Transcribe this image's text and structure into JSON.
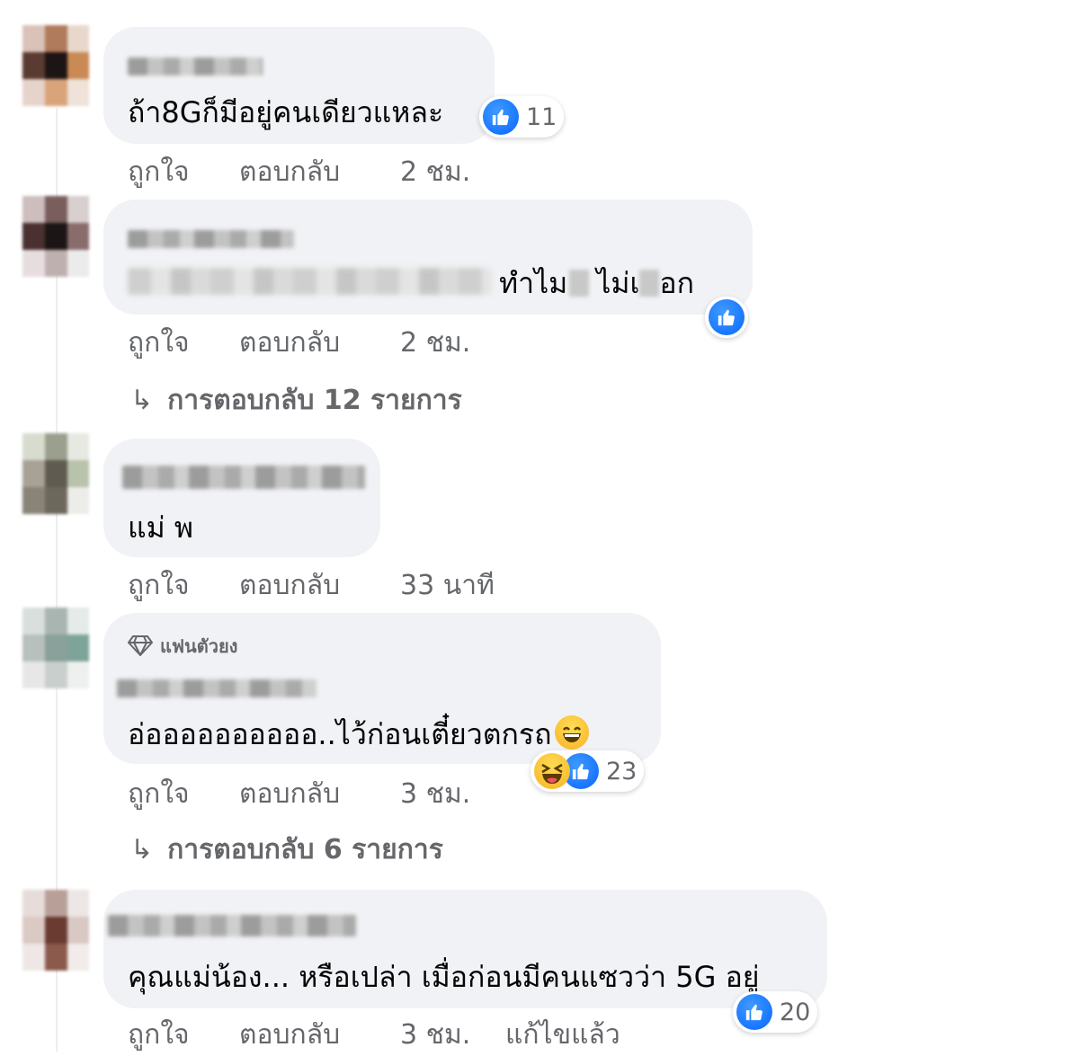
{
  "actions": {
    "like": "ถูกใจ",
    "reply": "ตอบกลับ"
  },
  "icons": {
    "reaction_like": "like-icon",
    "reaction_haha": "haha-icon",
    "reply_arrow": "reply-arrow-icon",
    "badge": "diamond-icon"
  },
  "colors": {
    "like_blue": "#0866ff",
    "bubble_bg": "#f0f2f5",
    "secondary_text": "#65676b"
  },
  "comments": [
    {
      "text": "ถ้า8Gก็มีอยู่คนเดียวแหละ",
      "time": "2 ชม.",
      "reaction_count": "11"
    },
    {
      "text_visible_1": "ทำไม",
      "text_visible_2": "ไม่เ",
      "text_visible_3": "อก",
      "time": "2 ชม.",
      "replies_label": "การตอบกลับ 12 รายการ"
    },
    {
      "text": "แม่ พ",
      "time": "33 นาที"
    },
    {
      "badge": "แฟนตัวยง",
      "text": "อ่ออออออออออ..ไว้ก่อนเตี๋ยวตกรถ",
      "time": "3 ชม.",
      "reaction_count": "23",
      "replies_label": "การตอบกลับ 6 รายการ"
    },
    {
      "text": "คุณแม่น้อง... หรือเปล่า เมื่อก่อนมีคนแซวว่า 5G อยู่",
      "time": "3 ชม.",
      "edited": "แก้ไขแล้ว",
      "reaction_count": "20"
    }
  ]
}
